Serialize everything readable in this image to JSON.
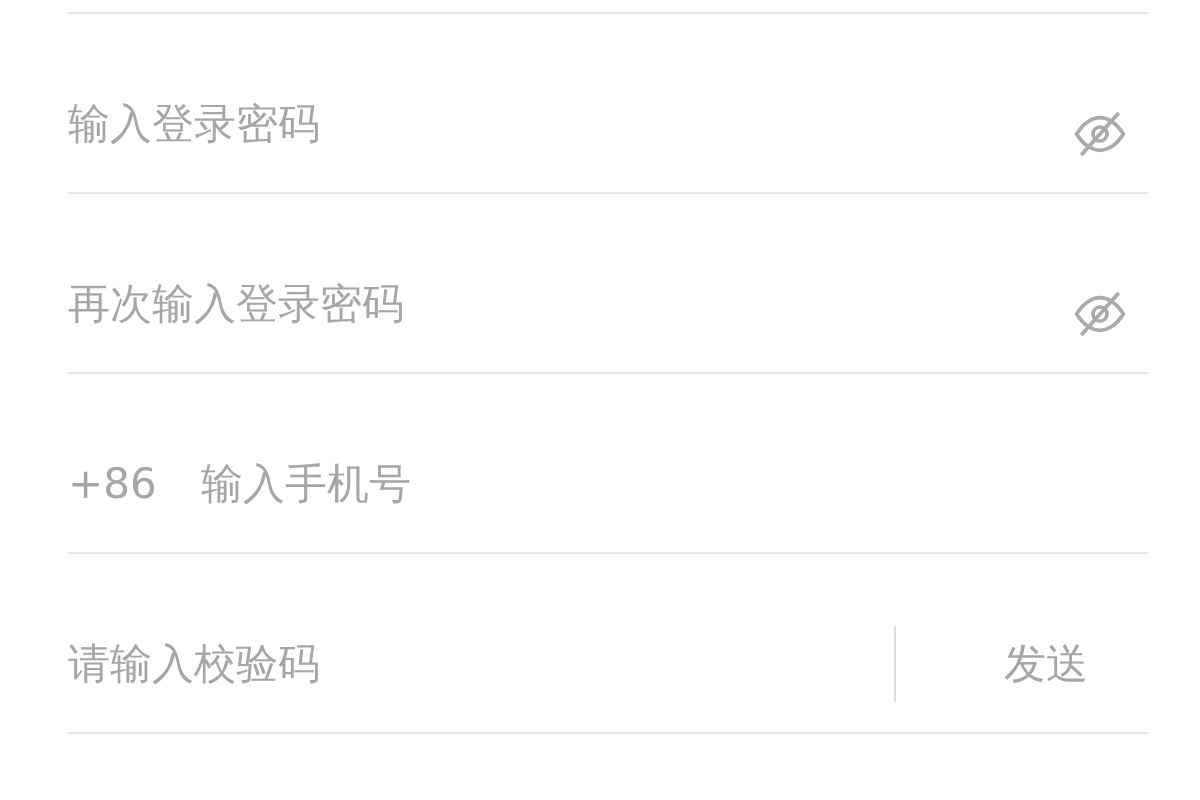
{
  "fields": [
    {
      "kind": "password",
      "placeholder": "输入登录密码",
      "password_visible": false
    },
    {
      "kind": "password",
      "placeholder": "再次输入登录密码",
      "password_visible": false
    },
    {
      "kind": "phone",
      "prefix": "+86",
      "placeholder": "输入手机号"
    },
    {
      "kind": "code",
      "placeholder": "请输入校验码",
      "button": "发送"
    }
  ]
}
